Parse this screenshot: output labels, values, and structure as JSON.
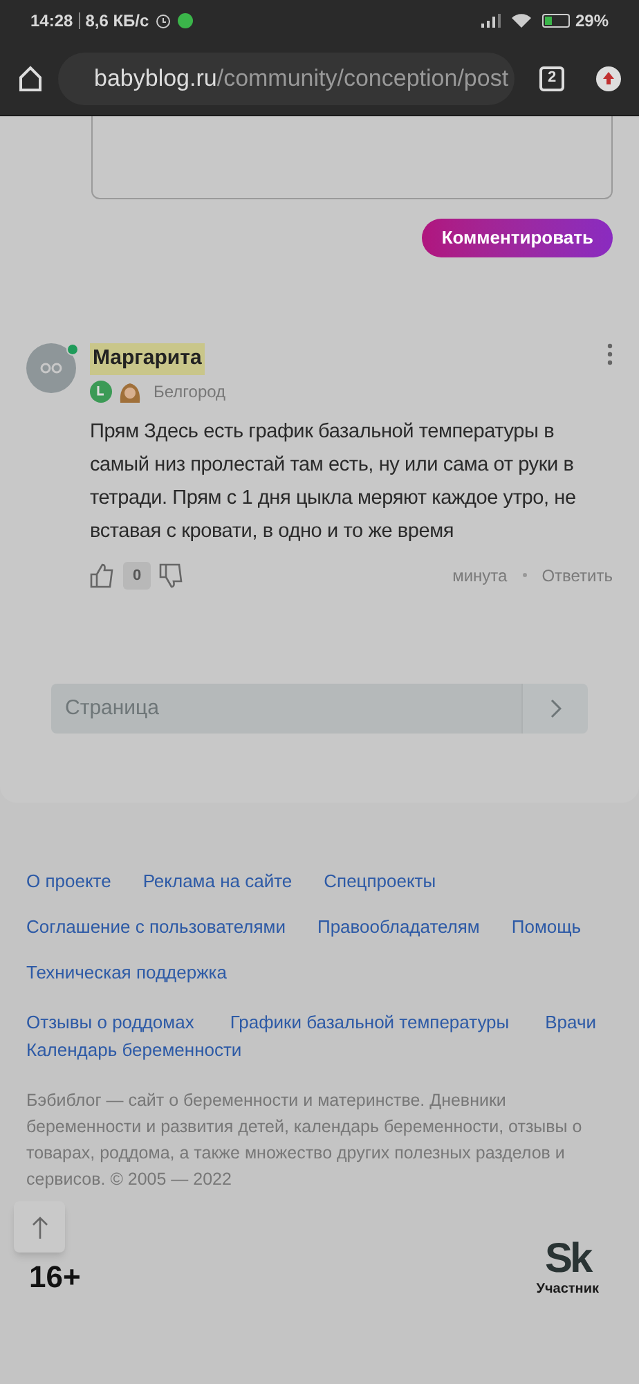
{
  "status_bar": {
    "time": "14:28",
    "speed": "8,6 КБ/с",
    "battery": "29%"
  },
  "browser": {
    "domain": "babyblog.ru",
    "path": "/community/conception/post",
    "tabs_count": "2"
  },
  "comment_form": {
    "submit": "Комментировать"
  },
  "comment": {
    "author": "Маргарита",
    "online": true,
    "city": "Белгород",
    "text": "Прям Здесь есть график базальной температуры в самый низ пролестай там есть, ну или сама от руки в тетради. Прям с 1 дня цыкла меряют каждое утро, не вставая с кровати, в одно и то же время",
    "likes": "0",
    "time": "минута",
    "reply": "Ответить"
  },
  "pagination": {
    "placeholder": "Страница"
  },
  "footer": {
    "link_rows": [
      [
        "О проекте",
        "Реклама на сайте",
        "Спецпроекты"
      ],
      [
        "Соглашение с пользователями",
        "Правообладателям",
        "Помощь"
      ],
      [
        "Техническая поддержка"
      ],
      [
        "Отзывы о роддомах",
        "Графики базальной температуры",
        "Врачи",
        "Календарь беременности"
      ]
    ],
    "about": "Бэбиблог — сайт о беременности и материнстве. Дневники беременности и развития детей, календарь беременности, отзывы о товарах, роддома, а также множество других полезных разделов и сервисов. © 2005 — 2022",
    "age": "16+",
    "sk_logo": "Sk",
    "sk_caption": "Участник"
  }
}
